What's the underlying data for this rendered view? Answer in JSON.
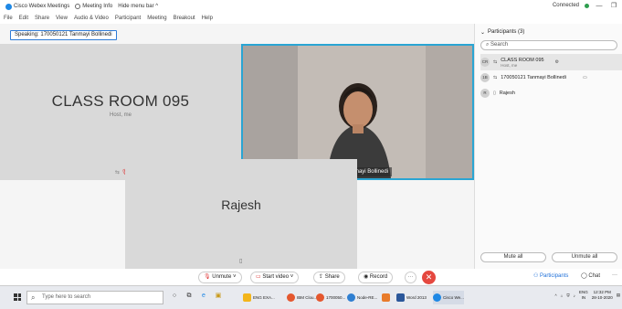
{
  "window": {
    "app_name": "Cisco Webex Meetings",
    "meeting_info": "Meeting Info",
    "hide_menu_bar": "Hide menu bar ^",
    "connected": "Connected",
    "minimize": "—",
    "restore": "❐"
  },
  "menu": [
    "File",
    "Edit",
    "Share",
    "View",
    "Audio & Video",
    "Participant",
    "Meeting",
    "Breakout",
    "Help"
  ],
  "speaking_label": "Speaking: 170050121 Tanmayi Bollinedi",
  "tiles": {
    "host_name": "CLASS ROOM 095",
    "host_sub": "Host, me",
    "video_label": "170050121 Tanmayi Bollinedi",
    "rajesh_name": "Rajesh"
  },
  "panel": {
    "title": "Participants (3)",
    "search_placeholder": "Search",
    "participants": [
      {
        "avatar": "CR",
        "name": "CLASS ROOM 095",
        "role": "Host, me"
      },
      {
        "avatar": "1B",
        "name": "170050121 Tanmayi Bollinedi",
        "role": ""
      },
      {
        "avatar": "R",
        "name": "Rajesh",
        "role": ""
      }
    ],
    "mute_all": "Mute all",
    "unmute_all": "Unmute all"
  },
  "controls": {
    "unmute": "Unmute",
    "start_video": "Start video",
    "share": "Share",
    "record": "Record",
    "more": "···",
    "leave": "✕",
    "participants_tab": "Participants",
    "chat_tab": "Chat",
    "overflow": "···"
  },
  "taskbar": {
    "search_placeholder": "Type here to search",
    "apps": [
      {
        "label": "ENG EXA...",
        "color": "#f3b51b"
      },
      {
        "label": "IBM Clou...",
        "color": "#e4572e"
      },
      {
        "label": "1700050...",
        "color": "#e4572e"
      },
      {
        "label": "Node-RE...",
        "color": "#2f7fd1"
      },
      {
        "label": "Word 2013",
        "color": "#2b579a"
      },
      {
        "label": "Cisco We...",
        "color": "#1e88e5"
      }
    ],
    "lang": "ENG",
    "region": "IN",
    "time": "12:32 PM",
    "date": "28-10-2020"
  }
}
